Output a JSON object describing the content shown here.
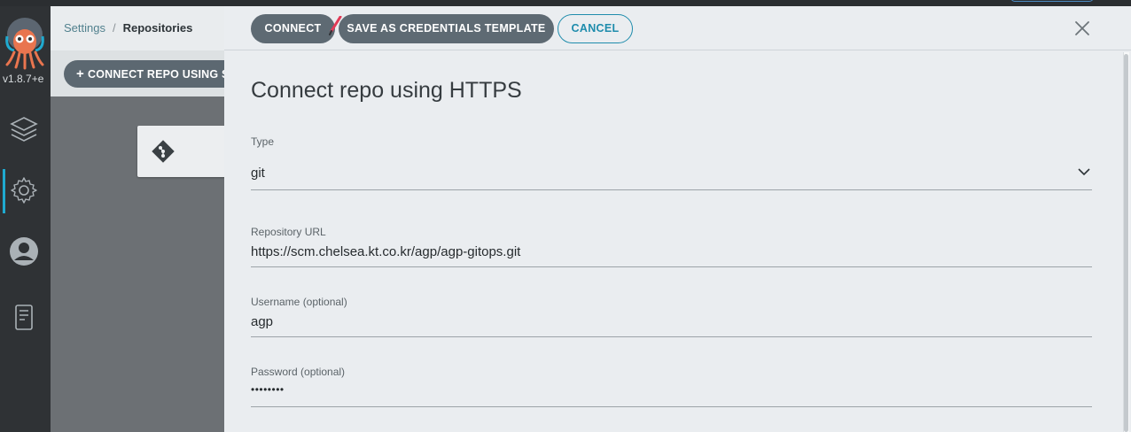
{
  "app": {
    "version": "v1.8.7+e",
    "brand_color": "#1faad0"
  },
  "nav": {
    "items": [
      {
        "icon": "layers-icon"
      },
      {
        "icon": "gear-icon"
      },
      {
        "icon": "user-icon"
      },
      {
        "icon": "docs-icon"
      }
    ]
  },
  "breadcrumb": {
    "settings": "Settings",
    "separator": "/",
    "current": "Repositories"
  },
  "toolbar": {
    "ssh_button": "CONNECT REPO USING SS"
  },
  "panel": {
    "connect_label": "CONNECT",
    "template_label": "SAVE AS CREDENTIALS TEMPLATE",
    "cancel_label": "CANCEL",
    "title": "Connect repo using HTTPS",
    "fields": {
      "type": {
        "label": "Type",
        "value": "git"
      },
      "url": {
        "label": "Repository URL",
        "value": "https://scm.chelsea.kt.co.kr/agp/agp-gitops.git"
      },
      "username": {
        "label": "Username (optional)",
        "value": "agp"
      },
      "password": {
        "label": "Password (optional)",
        "value": "••••••••"
      }
    }
  }
}
